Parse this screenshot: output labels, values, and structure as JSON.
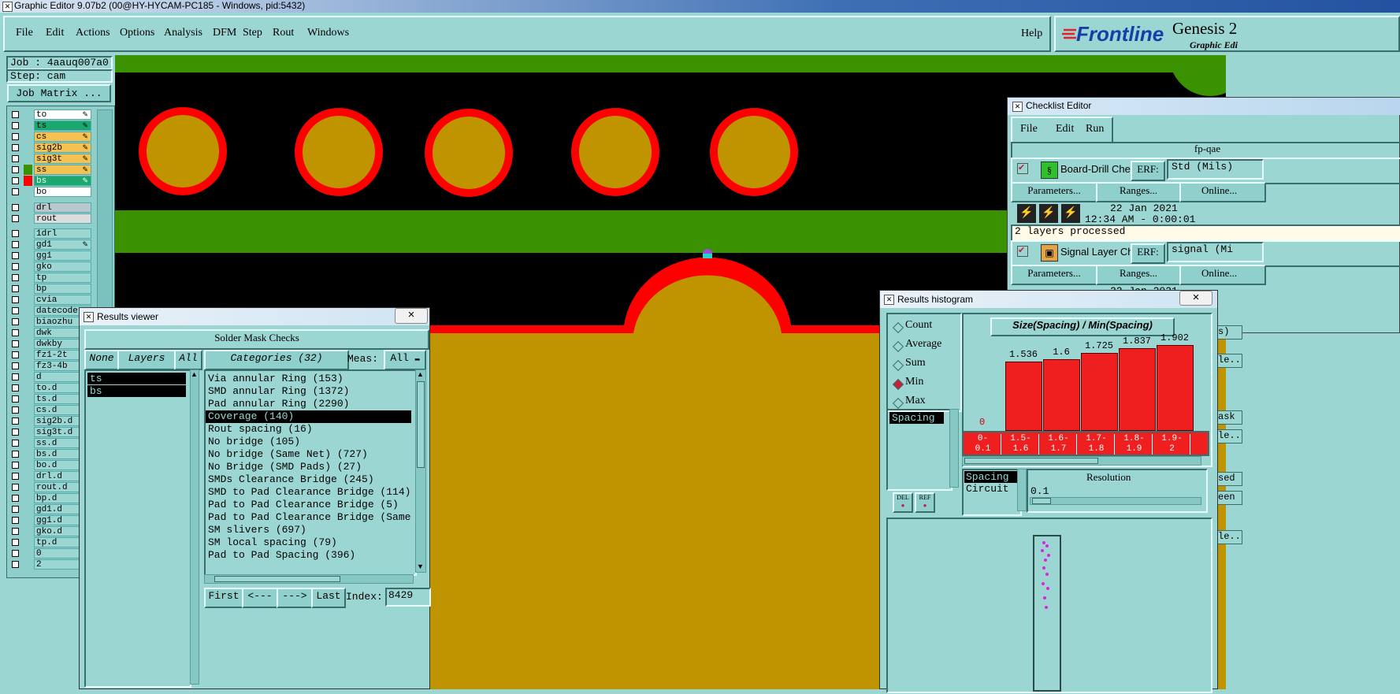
{
  "window_title": "Graphic Editor 9.07b2 (00@HY-HYCAM-PC185 - Windows, pid:5432)",
  "menu": [
    "File",
    "Edit",
    "Actions",
    "Options",
    "Analysis",
    "DFM",
    "Step",
    "Rout",
    "Windows"
  ],
  "help_label": "Help",
  "brand": {
    "logo": "Frontline",
    "product": "Genesis 2",
    "subtitle": "Graphic Edi"
  },
  "job": {
    "job_line": "Job : 4aauq007a0",
    "step_line": "Step: cam",
    "matrix_button": "Job Matrix ..."
  },
  "layers_group1": [
    {
      "name": "to",
      "color": "#ffffff",
      "edit": true
    },
    {
      "name": "ts",
      "color": "#1aa86e",
      "edit": true
    },
    {
      "name": "cs",
      "color": "#f5c150",
      "edit": true
    },
    {
      "name": "sig2b",
      "color": "#f5c150",
      "edit": true
    },
    {
      "name": "sig3t",
      "color": "#f5c150",
      "edit": true
    },
    {
      "name": "ss",
      "color": "#f5c150",
      "edit": true
    },
    {
      "name": "bs",
      "color": "#1aa86e",
      "edit": true
    },
    {
      "name": "bo",
      "color": "#ffffff",
      "edit": false
    }
  ],
  "layers_group2": [
    "drl",
    "rout"
  ],
  "layers_group3": [
    "1drl",
    "gd1",
    "gg1",
    "gko",
    "tp",
    "bp",
    "cvia",
    "datecode-",
    "biaozhu",
    "dwk",
    "dwkby",
    "fz1-2t",
    "fz3-4b",
    "d",
    "to.d",
    "ts.d",
    "cs.d",
    "sig2b.d",
    "sig3t.d",
    "ss.d",
    "bs.d",
    "bo.d",
    "drl.d",
    "rout.d",
    "bp.d",
    "gd1.d",
    "gg1.d",
    "gko.d",
    "tp.d",
    "0",
    "2"
  ],
  "results_viewer": {
    "title": "Results viewer",
    "close": "×",
    "heading": "Solder Mask Checks",
    "none_btn": "None",
    "layers_btn": "Layers",
    "all_btn": "All",
    "categories_btn": "Categories (32)",
    "meas_label": "Meas:",
    "meas_value": "All",
    "layers": [
      "ts",
      "bs"
    ],
    "categories": [
      "Via annular Ring (153)",
      "SMD annular Ring (1372)",
      "Pad annular Ring (2290)",
      "Coverage (140)",
      "Rout spacing (16)",
      "No bridge (105)",
      "No bridge (Same Net) (727)",
      "No Bridge (SMD Pads) (27)",
      "SMDs Clearance Bridge (245)",
      "SMD to Pad Clearance Bridge (114)",
      "Pad to Pad Clearance Bridge (5)",
      "Pad to Pad Clearance Bridge (Same",
      "SM slivers (697)",
      "SM local spacing (79)",
      "Pad to Pad Spacing (396)"
    ],
    "selected_category": 3,
    "nav": {
      "first": "First",
      "prev": "<---",
      "next": "--->",
      "last": "Last",
      "index_label": "Index:",
      "index_value": "8429"
    }
  },
  "checklist": {
    "title": "Checklist Editor",
    "menu": [
      "File",
      "Edit",
      "Run"
    ],
    "name": "fp-qae",
    "check1": {
      "name": "Board-Drill Che",
      "erf": "ERF:",
      "erf_value": "Std (Mils)",
      "params": "Parameters...",
      "ranges": "Ranges...",
      "online": "Online...",
      "date": "22 Jan 2021",
      "time": "12:34 AM - 0:00:01",
      "status": "2 layers processed"
    },
    "check2": {
      "name": "Signal Layer Ch",
      "erf": "ERF:",
      "erf_value": "signal (Mi",
      "params": "Parameters...",
      "ranges": "Ranges...",
      "online": "Online...",
      "date": "22 Jan 2021"
    },
    "right_fragments": [
      "s)",
      "le..",
      "ask",
      "le..",
      "sed",
      "een",
      "le.."
    ]
  },
  "histogram": {
    "title": "Results histogram",
    "close": "×",
    "modes": [
      "Count",
      "Average",
      "Sum",
      "Min",
      "Max"
    ],
    "selected_mode": "Min",
    "field_list": [
      "Spacing"
    ],
    "chart_title": "Size(Spacing) / Min(Spacing)",
    "zero_label": "0",
    "bins": [
      "0-\n0.1",
      "1.5-\n1.6",
      "1.6-\n1.7",
      "1.7-\n1.8",
      "1.8-\n1.9",
      "1.9-\n2"
    ],
    "value_labels": [
      "",
      "1.536",
      "1.6",
      "1.725",
      "1.837",
      "1.902"
    ],
    "param_list": [
      "Spacing",
      "Circuit"
    ],
    "resolution_label": "Resolution",
    "resolution_value": "0.1",
    "btn1": "DEL",
    "btn2": "REF"
  },
  "chart_data": {
    "type": "bar",
    "title": "Size(Spacing) / Min(Spacing)",
    "categories": [
      "0-0.1",
      "1.5-1.6",
      "1.6-1.7",
      "1.7-1.8",
      "1.8-1.9",
      "1.9-2"
    ],
    "values": [
      0,
      1.536,
      1.6,
      1.725,
      1.837,
      1.902
    ],
    "ylim": [
      0,
      2.1
    ],
    "grid": false
  },
  "colors": {
    "board_bg": "#000000",
    "copper": "#bf9400",
    "mask_ring": "#ff0000",
    "plane": "#3a9200",
    "panel": "#9cd6d3"
  }
}
